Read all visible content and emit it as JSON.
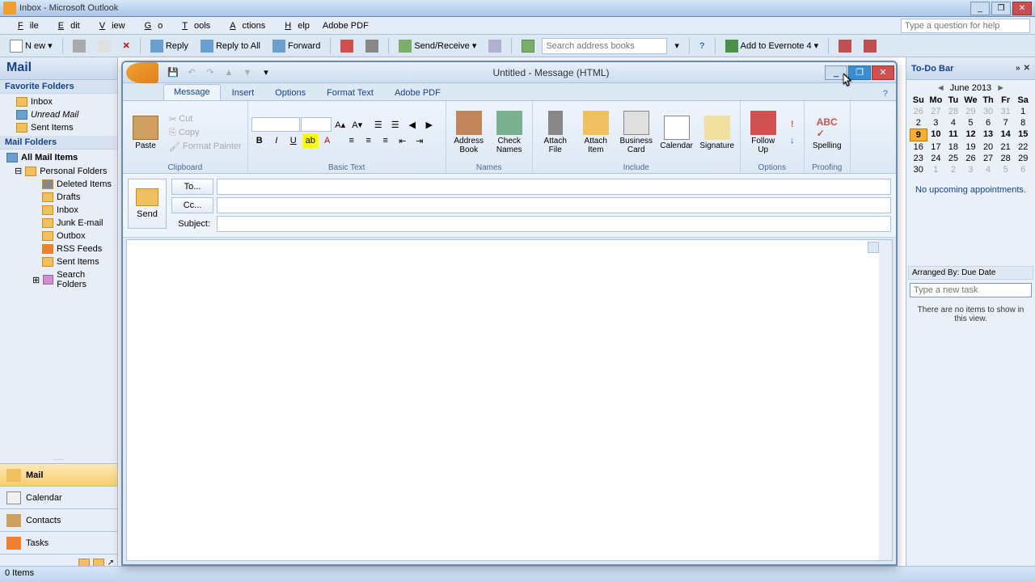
{
  "window": {
    "title": "Inbox - Microsoft Outlook"
  },
  "menus": [
    "File",
    "Edit",
    "View",
    "Go",
    "Tools",
    "Actions",
    "Help",
    "Adobe PDF"
  ],
  "askbox": "Type a question for help",
  "toolbar": {
    "new": "New",
    "reply": "Reply",
    "replyall": "Reply to All",
    "forward": "Forward",
    "sendreceive": "Send/Receive",
    "search": "Search address books",
    "evernote": "Add to Evernote 4"
  },
  "leftpane": {
    "header": "Mail",
    "fav": "Favorite Folders",
    "favitems": [
      "Inbox",
      "Unread Mail",
      "Sent Items"
    ],
    "mailfolders": "Mail Folders",
    "allmail": "All Mail Items",
    "personal": "Personal Folders",
    "subitems": [
      "Deleted Items",
      "Drafts",
      "Inbox",
      "Junk E-mail",
      "Outbox",
      "RSS Feeds",
      "Sent Items",
      "Search Folders"
    ]
  },
  "nav": {
    "mail": "Mail",
    "calendar": "Calendar",
    "contacts": "Contacts",
    "tasks": "Tasks"
  },
  "todo": {
    "header": "To-Do Bar",
    "month": "June 2013",
    "days": [
      "Su",
      "Mo",
      "Tu",
      "We",
      "Th",
      "Fr",
      "Sa"
    ],
    "noappt": "No upcoming appointments.",
    "arranged": "Arranged By: Due Date",
    "newtask": "Type a new task",
    "noitems": "There are no items to show in this view."
  },
  "compose": {
    "title": "Untitled - Message (HTML)",
    "tabs": [
      "Message",
      "Insert",
      "Options",
      "Format Text",
      "Adobe PDF"
    ],
    "paste": "Paste",
    "cut": "Cut",
    "copy": "Copy",
    "fmtpainter": "Format Painter",
    "clipboard": "Clipboard",
    "basictext": "Basic Text",
    "addrbook": "Address\nBook",
    "checknames": "Check\nNames",
    "names": "Names",
    "attachfile": "Attach\nFile",
    "attachitem": "Attach\nItem",
    "bizcard": "Business\nCard",
    "calendar": "Calendar",
    "signature": "Signature",
    "include": "Include",
    "followup": "Follow\nUp",
    "options": "Options",
    "spelling": "Spelling",
    "proofing": "Proofing",
    "send": "Send",
    "to": "To...",
    "cc": "Cc...",
    "subject": "Subject:"
  },
  "status": "0 Items"
}
